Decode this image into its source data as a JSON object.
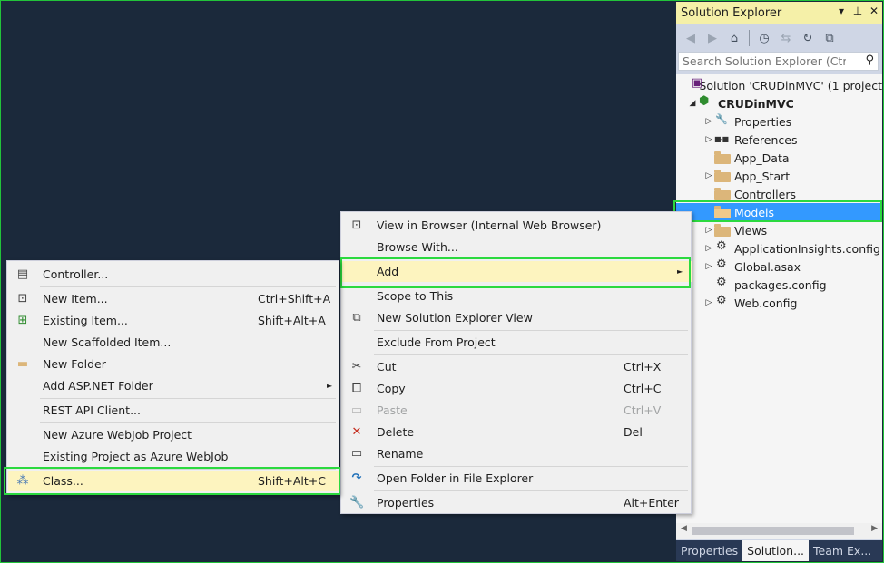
{
  "solution_explorer": {
    "title": "Solution Explorer",
    "search_placeholder": "Search Solution Explorer (Ctrl+",
    "tree": [
      {
        "label": "Solution 'CRUDinMVC' (1 project",
        "icon": "vs-solution-icon",
        "arrow": ""
      },
      {
        "label": "CRUDinMVC",
        "icon": "csharp-project-icon",
        "arrow": "◢",
        "bold": true
      },
      {
        "label": "Properties",
        "icon": "wrench-icon",
        "arrow": "▷"
      },
      {
        "label": "References",
        "icon": "references-icon",
        "arrow": "▷"
      },
      {
        "label": "App_Data",
        "icon": "folder-icon",
        "arrow": ""
      },
      {
        "label": "App_Start",
        "icon": "folder-icon",
        "arrow": "▷"
      },
      {
        "label": "Controllers",
        "icon": "folder-icon",
        "arrow": ""
      },
      {
        "label": "Models",
        "icon": "folder-icon",
        "arrow": "",
        "selected": true
      },
      {
        "label": "Views",
        "icon": "folder-icon",
        "arrow": "▷"
      },
      {
        "label": "ApplicationInsights.config",
        "icon": "config-icon",
        "arrow": "▷"
      },
      {
        "label": "Global.asax",
        "icon": "config-icon",
        "arrow": "▷"
      },
      {
        "label": "packages.config",
        "icon": "config-icon",
        "arrow": ""
      },
      {
        "label": "Web.config",
        "icon": "config-icon",
        "arrow": "▷"
      }
    ],
    "tabs": [
      "Properties",
      "Solution...",
      "Team Ex..."
    ]
  },
  "context_menu": {
    "items": [
      {
        "label": "View in Browser (Internal Web Browser)",
        "icon": "browser-icon"
      },
      {
        "label": "Browse With...",
        "icon": ""
      },
      {
        "label": "Add",
        "icon": "",
        "submenu": "►"
      },
      {
        "label": "Scope to This",
        "icon": ""
      },
      {
        "label": "New Solution Explorer View",
        "icon": "new-view-icon"
      },
      {
        "label": "Exclude From Project",
        "icon": ""
      },
      {
        "label": "Cut",
        "shortcut": "Ctrl+X",
        "icon": "cut-icon"
      },
      {
        "label": "Copy",
        "shortcut": "Ctrl+C",
        "icon": "copy-icon"
      },
      {
        "label": "Paste",
        "shortcut": "Ctrl+V",
        "icon": "paste-icon"
      },
      {
        "label": "Delete",
        "shortcut": "Del",
        "icon": "delete-icon"
      },
      {
        "label": "Rename",
        "icon": "rename-icon"
      },
      {
        "label": "Open Folder in File Explorer",
        "icon": "open-folder-icon"
      },
      {
        "label": "Properties",
        "shortcut": "Alt+Enter",
        "icon": "wrench-icon"
      }
    ]
  },
  "add_submenu": {
    "items": [
      {
        "label": "Controller...",
        "icon": "controller-icon"
      },
      {
        "label": "New Item...",
        "shortcut": "Ctrl+Shift+A",
        "icon": "new-item-icon"
      },
      {
        "label": "Existing Item...",
        "shortcut": "Shift+Alt+A",
        "icon": "existing-item-icon"
      },
      {
        "label": "New Scaffolded Item...",
        "icon": ""
      },
      {
        "label": "New Folder",
        "icon": "new-folder-icon"
      },
      {
        "label": "Add ASP.NET Folder",
        "icon": "",
        "submenu": "►"
      },
      {
        "label": "REST API Client...",
        "icon": ""
      },
      {
        "label": "New Azure WebJob Project",
        "icon": ""
      },
      {
        "label": "Existing Project as Azure WebJob",
        "icon": ""
      },
      {
        "label": "Class...",
        "shortcut": "Shift+Alt+C",
        "icon": "class-icon"
      }
    ]
  },
  "colors": {
    "background": "#1b293b",
    "highlight_box": "#2bd93f",
    "menu_highlight": "#fdf4bf",
    "selection": "#3399ff"
  }
}
